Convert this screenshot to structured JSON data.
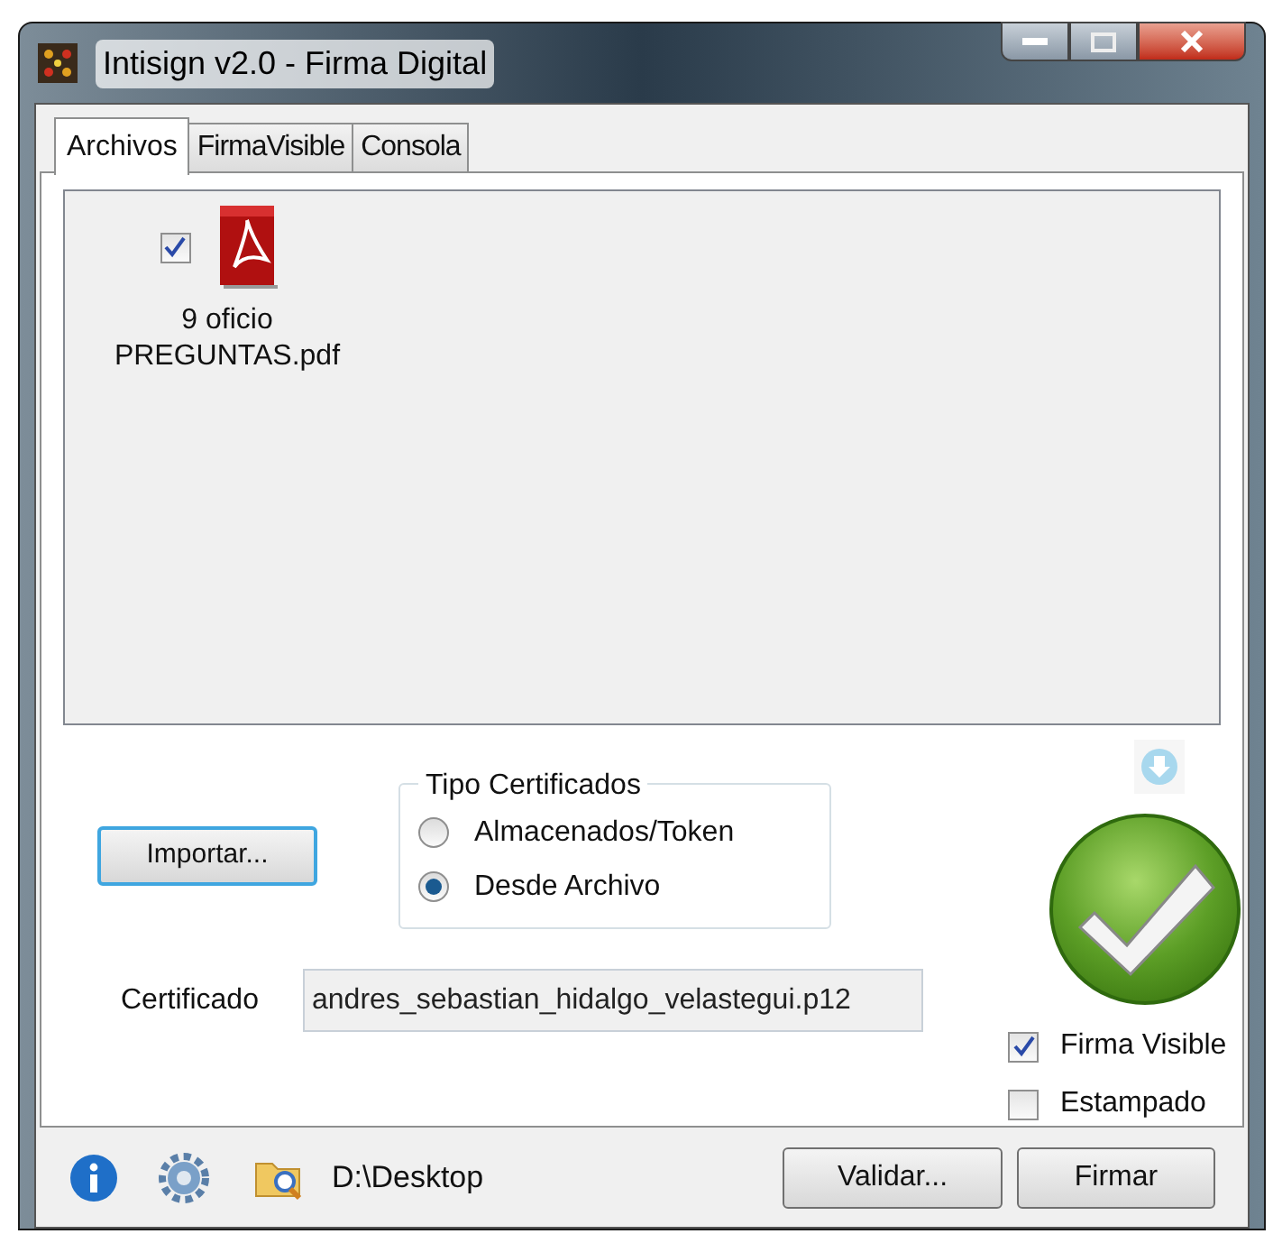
{
  "window": {
    "title": "Intisign v2.0 - Firma Digital"
  },
  "tabs": [
    {
      "label": "Archivos",
      "selected": true
    },
    {
      "label": "FirmaVisible",
      "selected": false
    },
    {
      "label": "Consola",
      "selected": false
    }
  ],
  "files": [
    {
      "name": "9 oficio PREGUNTAS.pdf",
      "checked": true
    }
  ],
  "import_button": "Importar...",
  "certificate_type": {
    "legend": "Tipo Certificados",
    "options": [
      {
        "label": "Almacenados/Token",
        "selected": false
      },
      {
        "label": "Desde Archivo",
        "selected": true
      }
    ]
  },
  "certificate": {
    "label": "Certificado",
    "value": "andres_sebastian_hidalgo_velastegui.p12"
  },
  "options": [
    {
      "label": "Firma Visible",
      "checked": true
    },
    {
      "label": "Estampado",
      "checked": false
    }
  ],
  "status_bar": {
    "path": "D:\\Desktop"
  },
  "buttons": [
    "Validar...",
    "Firmar"
  ]
}
